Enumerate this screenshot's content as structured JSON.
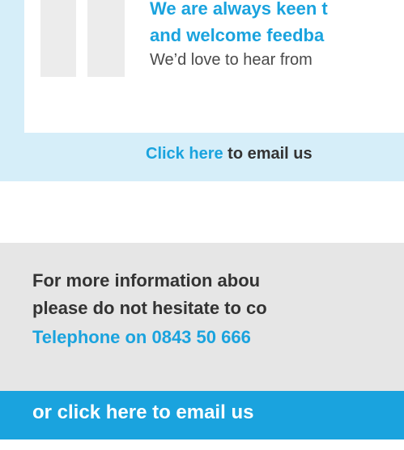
{
  "feedback": {
    "heading_line1": "We are always keen t",
    "heading_line2": "and welcome feedba",
    "subtext": "We’d love to hear from",
    "email_link": "Click here",
    "email_rest": " to email us"
  },
  "contact": {
    "line1": "For more information abou",
    "line2": "please do not hesitate to co",
    "phone": "Telephone on 0843 50 666",
    "email_bar": "or click here to email us"
  },
  "colors": {
    "accent": "#1aa3de",
    "panel_light_blue": "#d6eef9",
    "panel_grey": "#e6e6e6",
    "text_dark": "#333333"
  },
  "icons": {
    "quote": "quote-mark-icon"
  }
}
